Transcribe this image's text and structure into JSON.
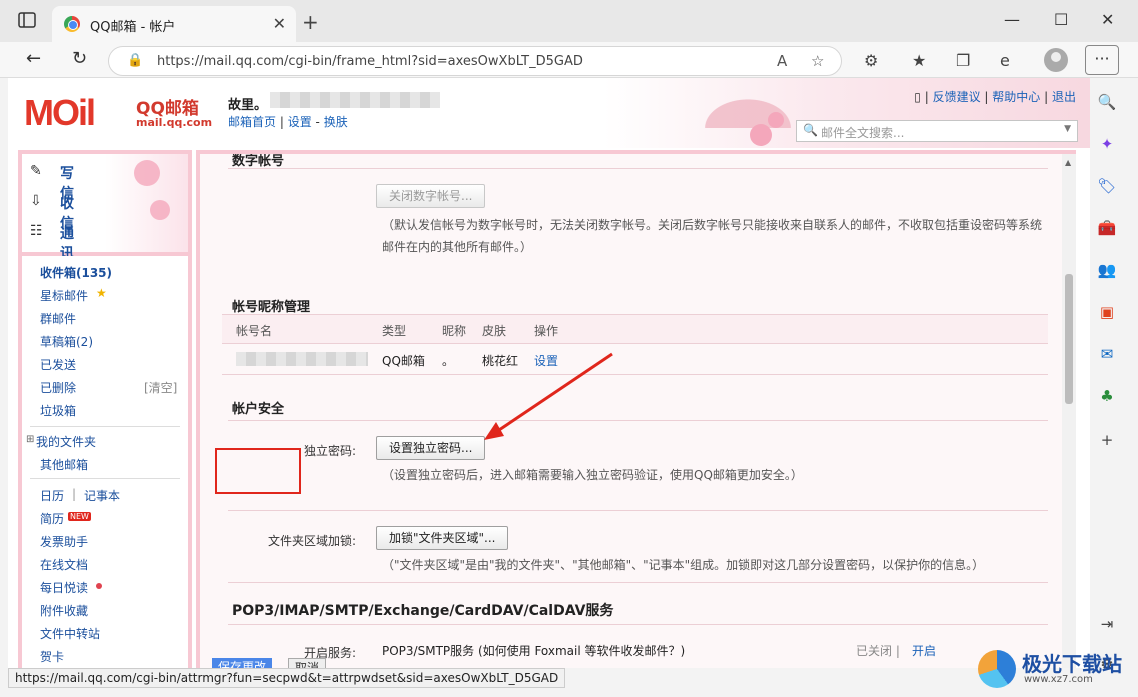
{
  "browser": {
    "tab_title": "QQ邮箱 - 帐户",
    "url": "https://mail.qq.com/cgi-bin/frame_html?sid=axesOwXbLT_D5GAD",
    "status_url": "https://mail.qq.com/cgi-bin/attrmgr?fun=secpwd&t=attrpwdset&sid=axesOwXbLT_D5GAD"
  },
  "header": {
    "logo_text": "MOil",
    "brand": "QQ邮箱",
    "domain": "mail.qq.com",
    "user_prefix": "故里。",
    "links": [
      "邮箱首页",
      "设置",
      "换肤"
    ],
    "top_links": [
      "反馈建议",
      "帮助中心",
      "退出"
    ],
    "search_placeholder": "邮件全文搜索..."
  },
  "compose": [
    {
      "label": "写信",
      "icon": "pencil-icon"
    },
    {
      "label": "收信",
      "icon": "inbox-icon"
    },
    {
      "label": "通讯录",
      "icon": "contacts-icon"
    }
  ],
  "folders": {
    "inbox": "收件箱(135)",
    "starred": "星标邮件",
    "group": "群邮件",
    "drafts": "草稿箱(2)",
    "sent": "已发送",
    "deleted": "已删除",
    "clear": "[清空]",
    "trash": "垃圾箱",
    "my_folders": "我的文件夹",
    "other_mailbox": "其他邮箱",
    "calendar": "日历",
    "notes": "记事本",
    "resume": "简历",
    "new_badge": "NEW",
    "invoice": "发票助手",
    "docs": "在线文档",
    "daily": "每日悦读",
    "attachments": "附件收藏",
    "transfer": "文件中转站",
    "cards": "贺卡"
  },
  "content": {
    "digital_title": "数字帐号",
    "close_digital_btn": "关闭数字帐号...",
    "digital_note": "（默认发信帐号为数字帐号时，无法关闭数字帐号。关闭后数字帐号只能接收来自联系人的邮件，不收取包括重设密码等系统邮件在内的其他所有邮件。）",
    "nickname_title": "帐号昵称管理",
    "table_headers": [
      "帐号名",
      "类型",
      "昵称",
      "皮肤",
      "操作"
    ],
    "table_row": {
      "type": "QQ邮箱",
      "nickname": "。",
      "skin": "桃花红",
      "action": "设置"
    },
    "security_title": "帐户安全",
    "pwd_label": "独立密码:",
    "pwd_btn": "设置独立密码...",
    "pwd_note": "（设置独立密码后，进入邮箱需要输入独立密码验证，使用QQ邮箱更加安全。）",
    "folder_lock_label": "文件夹区域加锁:",
    "folder_lock_btn": "加锁\"文件夹区域\"...",
    "folder_lock_note": "（\"文件夹区域\"是由\"我的文件夹\"、\"其他邮箱\"、\"记事本\"组成。加锁即对这几部分设置密码，以保护你的信息。）",
    "pop_title": "POP3/IMAP/SMTP/Exchange/CardDAV/CalDAV服务",
    "open_service_label": "开启服务:",
    "pop_service_text": "POP3/SMTP服务 (如何使用 Foxmail 等软件收发邮件？)",
    "pop_status": "已关闭 |",
    "pop_enable": "开启"
  },
  "bottom": {
    "save": "保存更改",
    "cancel": "取消"
  },
  "watermark": {
    "title": "极光下载站",
    "sub": "www.xz7.com"
  },
  "colors": {
    "accent": "#e0261c",
    "link": "#1b4f9c",
    "pink_frame": "#f7c8d3"
  }
}
